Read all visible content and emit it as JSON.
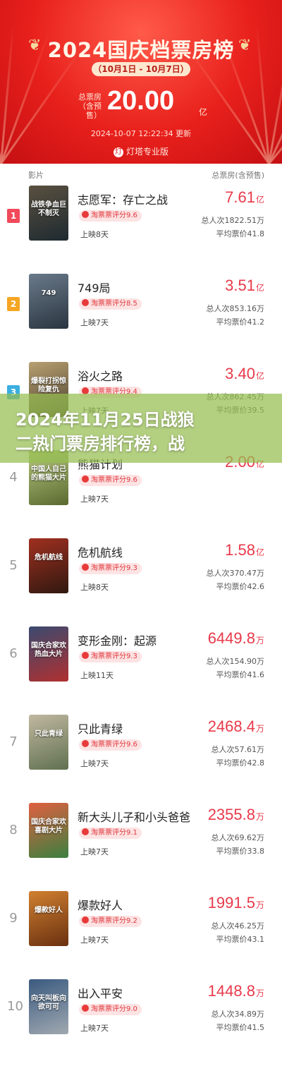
{
  "header": {
    "title": "2024国庆档票房榜",
    "date_range": "（10月1日 - 10月7日）",
    "total_label": "总票房（含预售）",
    "total_value": "20.00",
    "total_unit": "亿",
    "updated": "2024-10-07 12:22:34 更新",
    "brand": "灯塔专业版",
    "brand_logo": "灯"
  },
  "columns": {
    "film": "影片",
    "box": "总票房(含预售)"
  },
  "movies": [
    {
      "rank": "1",
      "name": "志愿军：存亡之战",
      "score": "淘票票评分9.6",
      "days": "上映8天",
      "box": "7.61",
      "unit": "亿",
      "people": "总人次1822.51万",
      "avg": "平均票价41.8",
      "poster_text": "战铁争血巨不制灭"
    },
    {
      "rank": "2",
      "name": "749局",
      "score": "淘票票评分8.5",
      "days": "上映7天",
      "box": "3.51",
      "unit": "亿",
      "people": "总人次853.16万",
      "avg": "平均票价41.2",
      "poster_text": "749"
    },
    {
      "rank": "3",
      "name": "浴火之路",
      "score": "淘票票评分9.4",
      "days": "上映7天",
      "box": "3.40",
      "unit": "亿",
      "people": "总人次862.45万",
      "avg": "平均票价39.5",
      "poster_text": "爆裂打拐惊险复仇"
    },
    {
      "rank": "4",
      "name": "熊猫计划",
      "score": "淘票票评分9.6",
      "days": "上映7天",
      "box": "2.00",
      "unit": "亿",
      "people": "",
      "avg": "",
      "poster_text": "中国人自己的熊猫大片"
    },
    {
      "rank": "5",
      "name": "危机航线",
      "score": "淘票票评分9.3",
      "days": "上映8天",
      "box": "1.58",
      "unit": "亿",
      "people": "总人次370.47万",
      "avg": "平均票价42.6",
      "poster_text": "危机航线"
    },
    {
      "rank": "6",
      "name": "变形金刚：起源",
      "score": "淘票票评分9.3",
      "days": "上映11天",
      "box": "6449.8",
      "unit": "万",
      "people": "总人次154.90万",
      "avg": "平均票价41.6",
      "poster_text": "国庆合家欢热血大片"
    },
    {
      "rank": "7",
      "name": "只此青绿",
      "score": "淘票票评分9.6",
      "days": "上映7天",
      "box": "2468.4",
      "unit": "万",
      "people": "总人次57.61万",
      "avg": "平均票价42.8",
      "poster_text": "只此青绿"
    },
    {
      "rank": "8",
      "name": "新大头儿子和小头爸爸",
      "score": "淘票票评分9.1",
      "days": "上映7天",
      "box": "2355.8",
      "unit": "万",
      "people": "总人次69.62万",
      "avg": "平均票价33.8",
      "poster_text": "国庆合家欢喜剧大片"
    },
    {
      "rank": "9",
      "name": "爆款好人",
      "score": "淘票票评分9.2",
      "days": "上映7天",
      "box": "1991.5",
      "unit": "万",
      "people": "总人次46.25万",
      "avg": "平均票价43.1",
      "poster_text": "爆款好人"
    },
    {
      "rank": "10",
      "name": "出入平安",
      "score": "淘票票评分9.0",
      "days": "上映7天",
      "box": "1448.8",
      "unit": "万",
      "people": "总人次34.89万",
      "avg": "平均票价41.5",
      "poster_text": "向天叫板向欲可可"
    }
  ],
  "overlay": {
    "line1": "2024年11月25日战狼",
    "line2": "二热门票房排行榜，战"
  },
  "colors": {
    "header_red": "#e8201c",
    "box_red": "#e8394a",
    "rank1": "#f14a5a",
    "rank2": "#f5a623",
    "rank3": "#3aaee0",
    "overlay": "#96be50"
  },
  "icons": {
    "score_icon": "taopiaopiao-icon",
    "wheat": "wheat-icon"
  }
}
